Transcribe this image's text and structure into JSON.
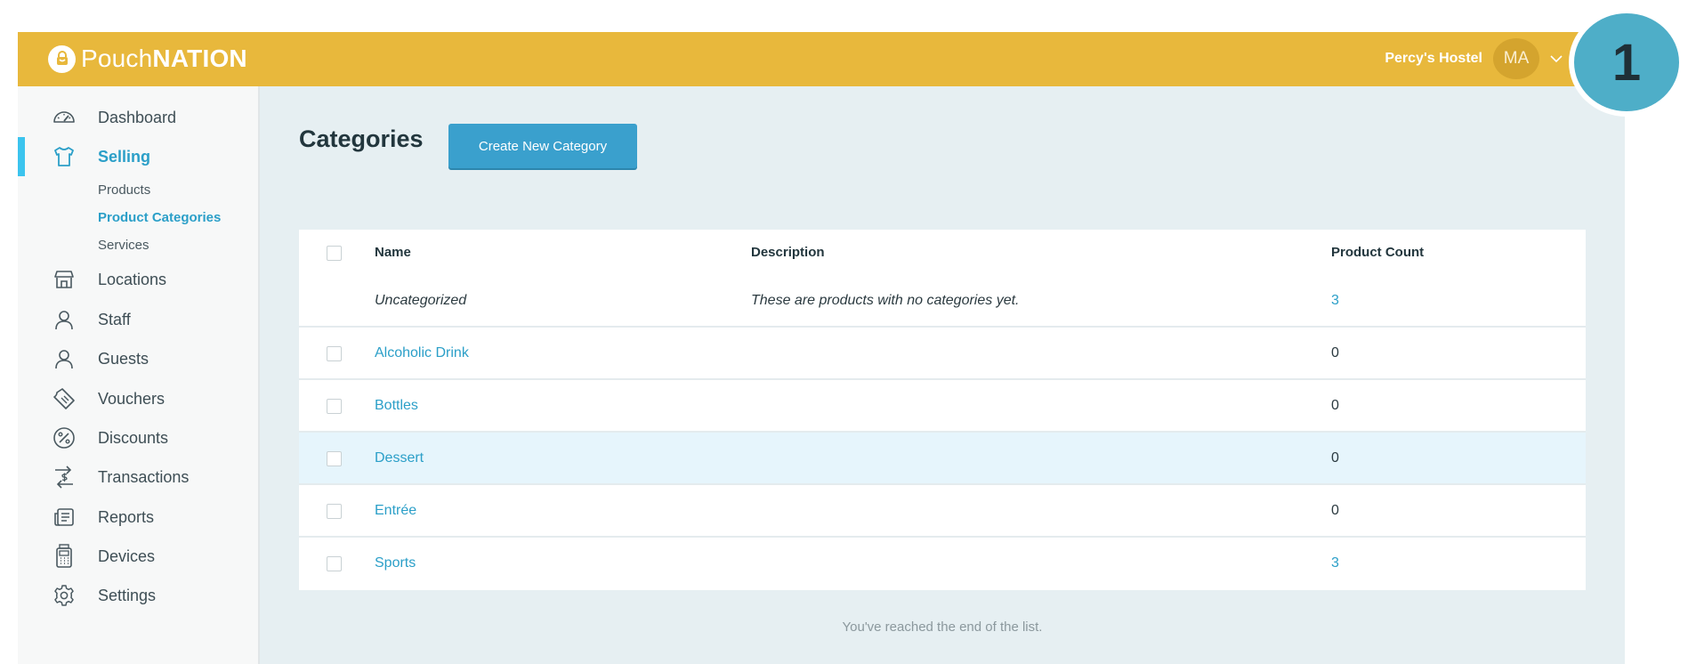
{
  "brand": {
    "name_light": "Pouch",
    "name_bold": "NATION"
  },
  "account": {
    "name": "Percy's Hostel",
    "initials": "MA"
  },
  "sidebar": {
    "items": [
      {
        "label": "Dashboard",
        "icon": "speedometer-icon"
      },
      {
        "label": "Selling",
        "icon": "tshirt-icon",
        "active": true
      },
      {
        "label": "Locations",
        "icon": "store-icon"
      },
      {
        "label": "Staff",
        "icon": "person-icon"
      },
      {
        "label": "Guests",
        "icon": "person-icon"
      },
      {
        "label": "Vouchers",
        "icon": "ticket-icon"
      },
      {
        "label": "Discounts",
        "icon": "percent-icon"
      },
      {
        "label": "Transactions",
        "icon": "transfer-dollar-icon"
      },
      {
        "label": "Reports",
        "icon": "report-icon"
      },
      {
        "label": "Devices",
        "icon": "pos-terminal-icon"
      },
      {
        "label": "Settings",
        "icon": "gear-icon"
      }
    ],
    "sub_items": [
      {
        "label": "Products"
      },
      {
        "label": "Product Categories",
        "active": true
      },
      {
        "label": "Services"
      }
    ]
  },
  "main": {
    "title": "Categories",
    "create_button": "Create New Category",
    "table": {
      "headers": {
        "name": "Name",
        "description": "Description",
        "count": "Product Count"
      },
      "uncategorized": {
        "name": "Uncategorized",
        "description": "These are products with no categories yet.",
        "count": "3"
      },
      "rows": [
        {
          "name": "Alcoholic Drink",
          "description": "",
          "count": "0"
        },
        {
          "name": "Bottles",
          "description": "",
          "count": "0"
        },
        {
          "name": "Dessert",
          "description": "",
          "count": "0"
        },
        {
          "name": "Entrée",
          "description": "",
          "count": "0"
        },
        {
          "name": "Sports",
          "description": "",
          "count": "3"
        }
      ]
    },
    "end_note": "You've reached the end of the list."
  },
  "step_badge": "1",
  "colors": {
    "topbar": "#e8b83c",
    "accent": "#2b9fc8",
    "button": "#3aa0cd",
    "active_bar": "#3cc4ee",
    "badge": "#4eaec8"
  }
}
